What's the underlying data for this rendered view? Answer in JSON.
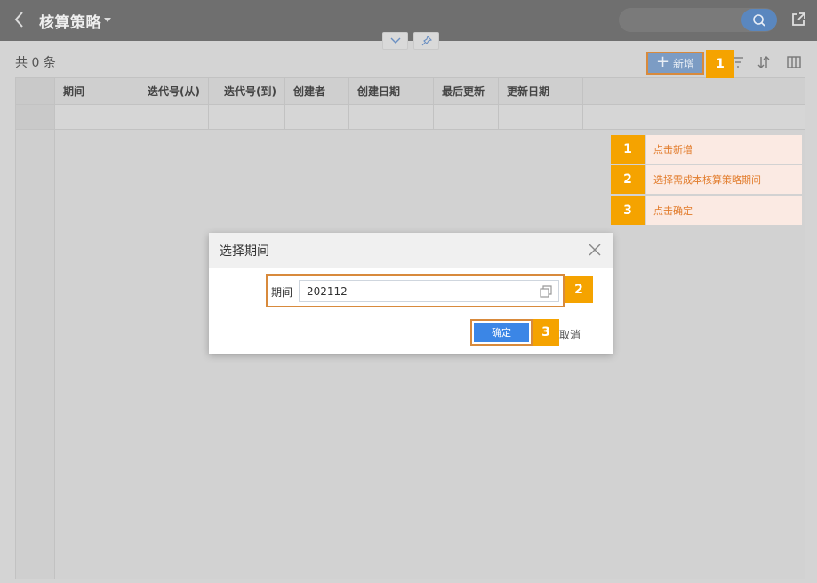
{
  "header": {
    "title": "核算策略",
    "back_icon": "chevron-left-icon",
    "search_icon": "search-icon",
    "share_icon": "external-link-icon"
  },
  "summary": {
    "count_text": "共 0 条"
  },
  "toolbar": {
    "add_label": "新增",
    "add_icon": "plus-icon",
    "icons": [
      "filter-icon",
      "sort-icon",
      "columns-icon"
    ]
  },
  "table": {
    "columns": [
      "期间",
      "迭代号(从)",
      "迭代号(到)",
      "创建者",
      "创建日期",
      "最后更新",
      "更新日期"
    ],
    "rows": []
  },
  "steps": [
    {
      "num": "1",
      "text": "点击新增"
    },
    {
      "num": "2",
      "text": "选择需成本核算策略期间"
    },
    {
      "num": "3",
      "text": "点击确定"
    }
  ],
  "dialog": {
    "title": "选择期间",
    "field_label": "期间",
    "field_value": "202112",
    "confirm_label": "确定",
    "cancel_label": "取消"
  },
  "badges": {
    "add": "1",
    "field": "2",
    "confirm": "3"
  },
  "colors": {
    "accent": "#3b86e6",
    "highlight": "#f5a300",
    "outline": "#d88a3c"
  }
}
